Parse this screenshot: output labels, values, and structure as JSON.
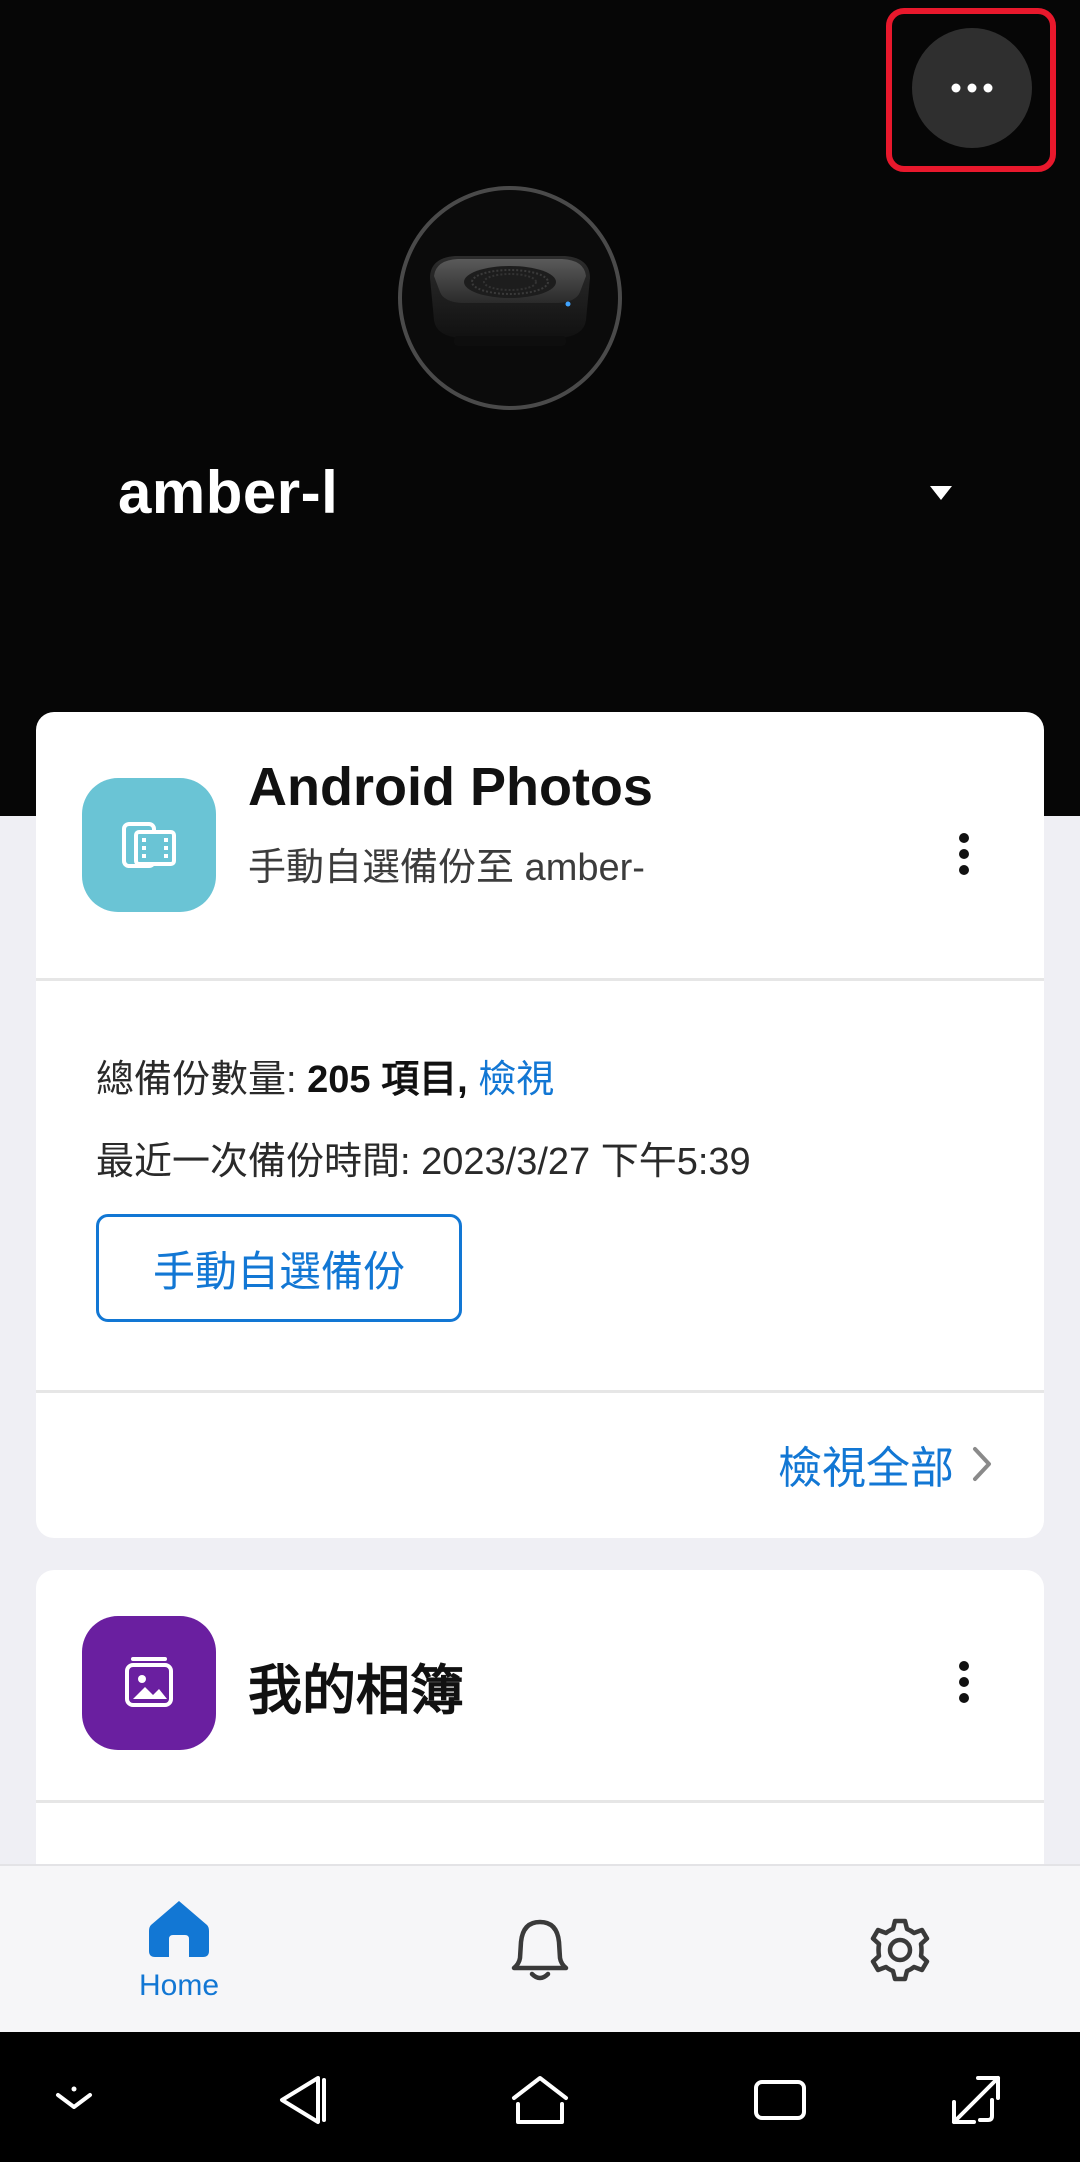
{
  "header": {
    "device_name": "amber-l",
    "more_button_label": "..."
  },
  "backup_card": {
    "title": "Android Photos",
    "subtitle": "手動自選備份至 amber-",
    "total_label": "總備份數量: ",
    "total_value": "205 項目",
    "total_sep": ",",
    "view_link": "檢視",
    "last_backup": "最近一次備份時間: 2023/3/27 下午5:39",
    "manual_button": "手動自選備份",
    "view_all": "檢視全部",
    "icon_color": "#6ac4d5"
  },
  "album_card": {
    "title": "我的相簿",
    "icon_color": "#6a1fa0"
  },
  "tabbar": {
    "home_label": "Home",
    "active_color": "#1277d4"
  },
  "colors": {
    "accent": "#1277d4",
    "header_bg": "#060606",
    "highlight_border": "#e8182c"
  }
}
